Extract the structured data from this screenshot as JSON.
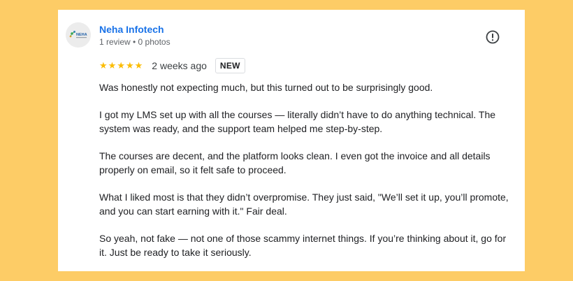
{
  "reviewer": {
    "name": "Neha Infotech",
    "meta": "1 review • 0 photos",
    "avatar_text": "NEHA"
  },
  "rating": {
    "stars": 5,
    "max_stars": 5,
    "time_ago": "2 weeks ago",
    "badge": "NEW"
  },
  "icons": {
    "report": "exclamation-circle-icon",
    "star": "star-icon"
  },
  "colors": {
    "background": "#FDCC66",
    "name_link": "#1a73e8",
    "star": "#fbbc04"
  },
  "review": {
    "paragraphs": [
      "Was honestly not expecting much, but this turned out to be surprisingly good.",
      "I got my LMS set up with all the courses — literally didn’t have to do anything technical. The system was ready, and the support team helped me step-by-step.",
      "The courses are decent, and the platform looks clean. I even got the invoice and all details properly on email, so it felt safe to proceed.",
      "What I liked most is that they didn’t overpromise. They just said, \"We’ll set it up, you’ll promote, and you can start earning with it.\" Fair deal.",
      "So yeah, not fake — not one of those scammy internet things. If you’re thinking about it, go for it. Just be ready to take it seriously."
    ]
  }
}
